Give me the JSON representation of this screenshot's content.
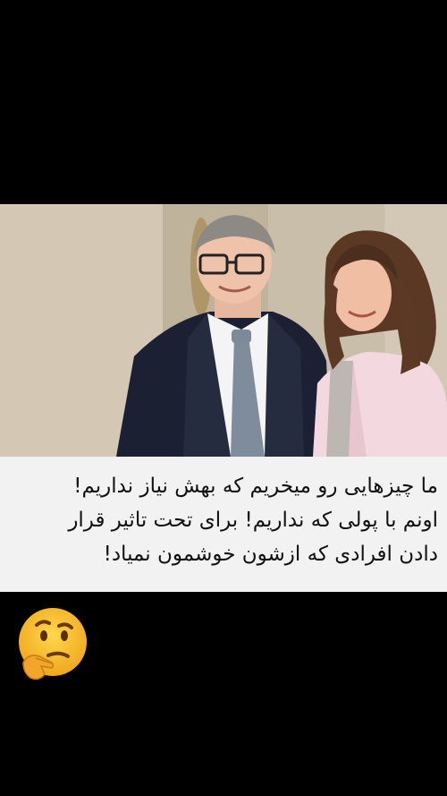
{
  "post": {
    "image_alt": "Couple photo",
    "caption_lines": [
      "ما چیزهایی رو میخریم که بهش نیاز نداریم!",
      "اونم با پولی که نداریم! برای تحت تاثیر قرار",
      "دادن افرادی که ازشون خوشمون نمیاد!"
    ]
  },
  "reaction": {
    "icon": "thinking-face-icon"
  },
  "colors": {
    "background": "#000000",
    "caption_bg": "#f2f2f2",
    "caption_text": "#111111",
    "emoji_yellow": "#f7b82b"
  }
}
